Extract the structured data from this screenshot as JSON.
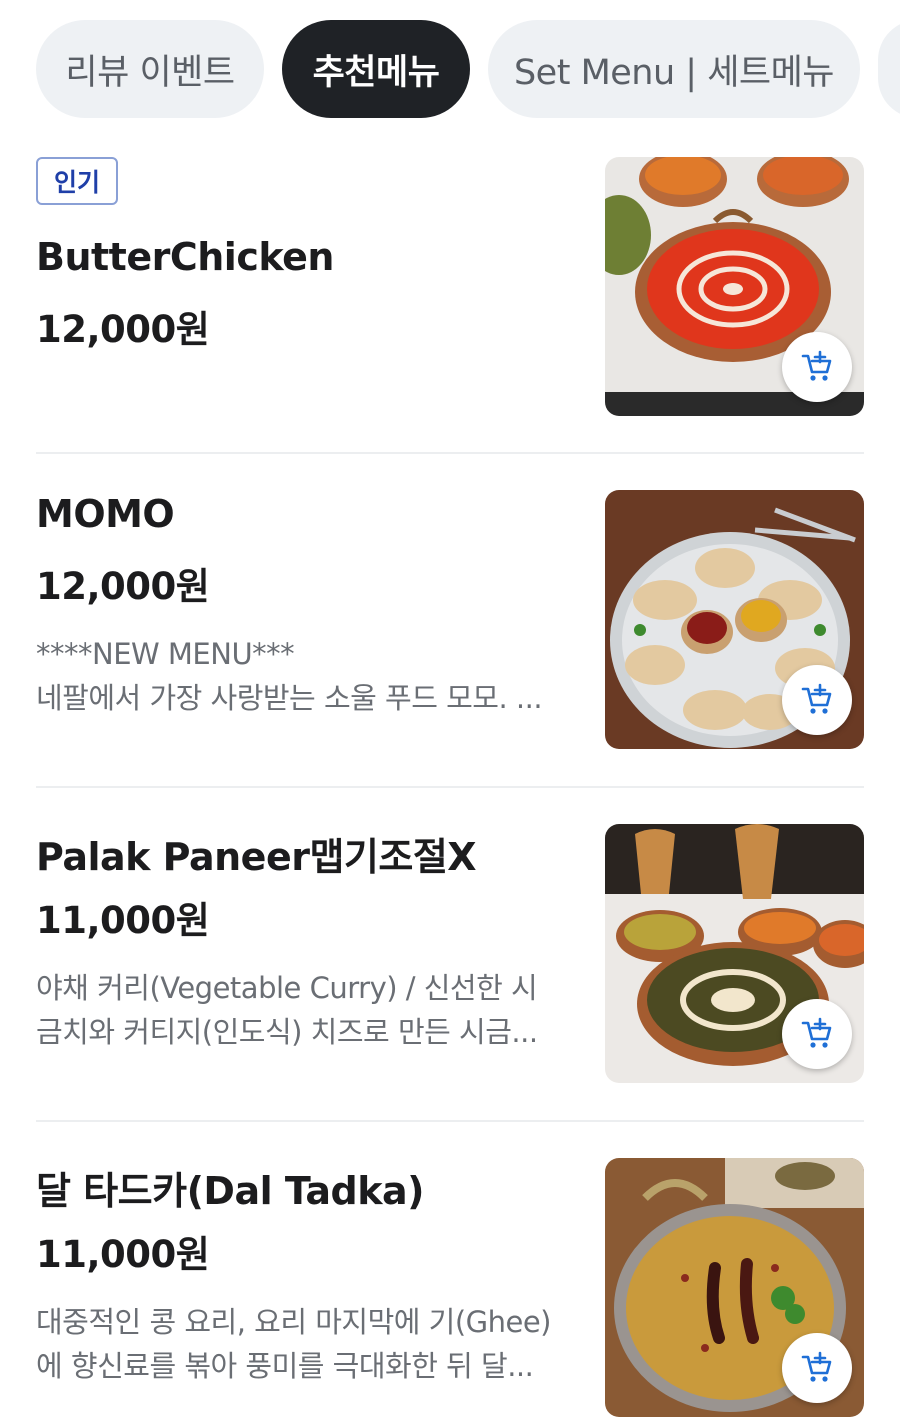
{
  "tabs": [
    {
      "label": "리뷰 이벤트",
      "active": false
    },
    {
      "label": "추천메뉴",
      "active": true
    },
    {
      "label": "Set Menu | 세트메뉴",
      "active": false
    },
    {
      "label": "",
      "active": false
    }
  ],
  "items": [
    {
      "badge": "인기",
      "name": "ButterChicken",
      "price": "12,000원",
      "desc": [],
      "image": "butter-chicken-photo"
    },
    {
      "badge": "",
      "name": "MOMO",
      "price": "12,000원",
      "desc": [
        "****NEW MENU***",
        "네팔에서 가장 사랑받는 소울 푸드 모모. ..."
      ],
      "image": "momo-photo"
    },
    {
      "badge": "",
      "name": "Palak Paneer맵기조절X",
      "price": "11,000원",
      "desc": [
        "야채 커리(Vegetable Curry) / 신선한 시",
        "금치와 커티지(인도식) 치즈로 만든 시금..."
      ],
      "image": "palak-paneer-photo"
    },
    {
      "badge": "",
      "name": "달 타드카(Dal Tadka)",
      "price": "11,000원",
      "desc": [
        "대중적인 콩 요리, 요리 마지막에 기(Ghee)",
        "에 향신료를 볶아 풍미를 극대화한 뒤 달..."
      ],
      "image": "dal-tadka-photo"
    }
  ],
  "icons": {
    "cart": "cart-add-icon"
  },
  "colors": {
    "accent": "#1f6fd6",
    "active_tab": "#1f2226",
    "badge": "#1f3fa8"
  }
}
